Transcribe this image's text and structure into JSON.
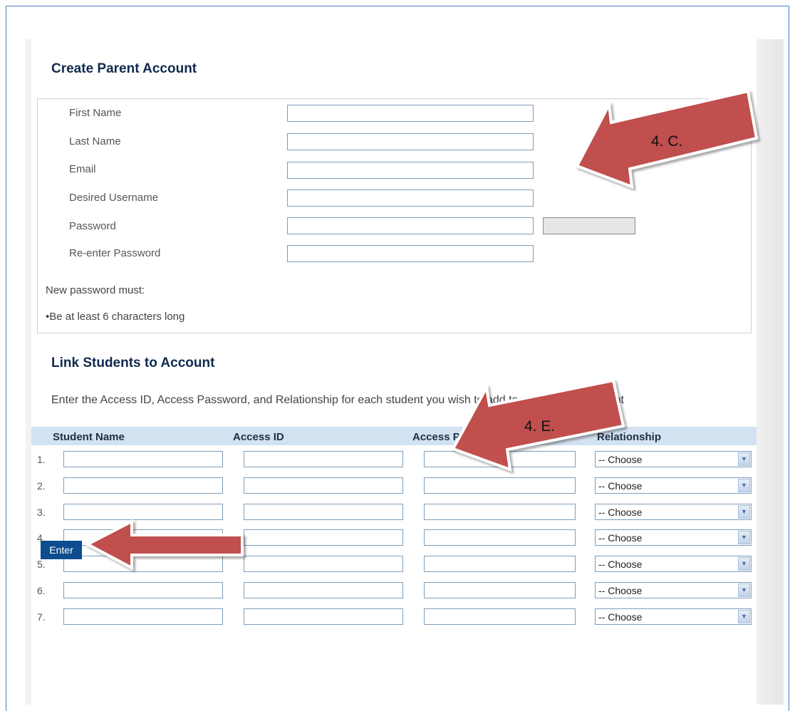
{
  "page": {
    "title": "Create Parent Account",
    "fields": [
      {
        "label": "First Name",
        "value": ""
      },
      {
        "label": "Last Name",
        "value": ""
      },
      {
        "label": "Email",
        "value": ""
      },
      {
        "label": "Desired Username",
        "value": ""
      },
      {
        "label": "Password",
        "value": ""
      },
      {
        "label": "Re-enter Password",
        "value": ""
      }
    ],
    "password_rules_title": "New password must:",
    "password_rule_1": "•Be at least 6 characters long"
  },
  "link": {
    "title": "Link Students to Account",
    "intro": "Enter the Access ID, Access Password, and Relationship for each student you wish to add to your Parent Account",
    "columns": [
      "Student Name",
      "Access ID",
      "Access Password",
      "Relationship"
    ],
    "rows": [
      "1.",
      "2.",
      "3.",
      "4.",
      "5.",
      "6.",
      "7."
    ],
    "select_value": "-- Choose"
  },
  "actions": {
    "enter_label": "Enter"
  },
  "annotations": {
    "arrow_c": "4. C.",
    "arrow_e": "4. E."
  },
  "colors": {
    "arrow": "#c0504d",
    "heading": "#0f2a4e",
    "button": "#0d4c8f",
    "table_header": "#d3e2f1"
  }
}
